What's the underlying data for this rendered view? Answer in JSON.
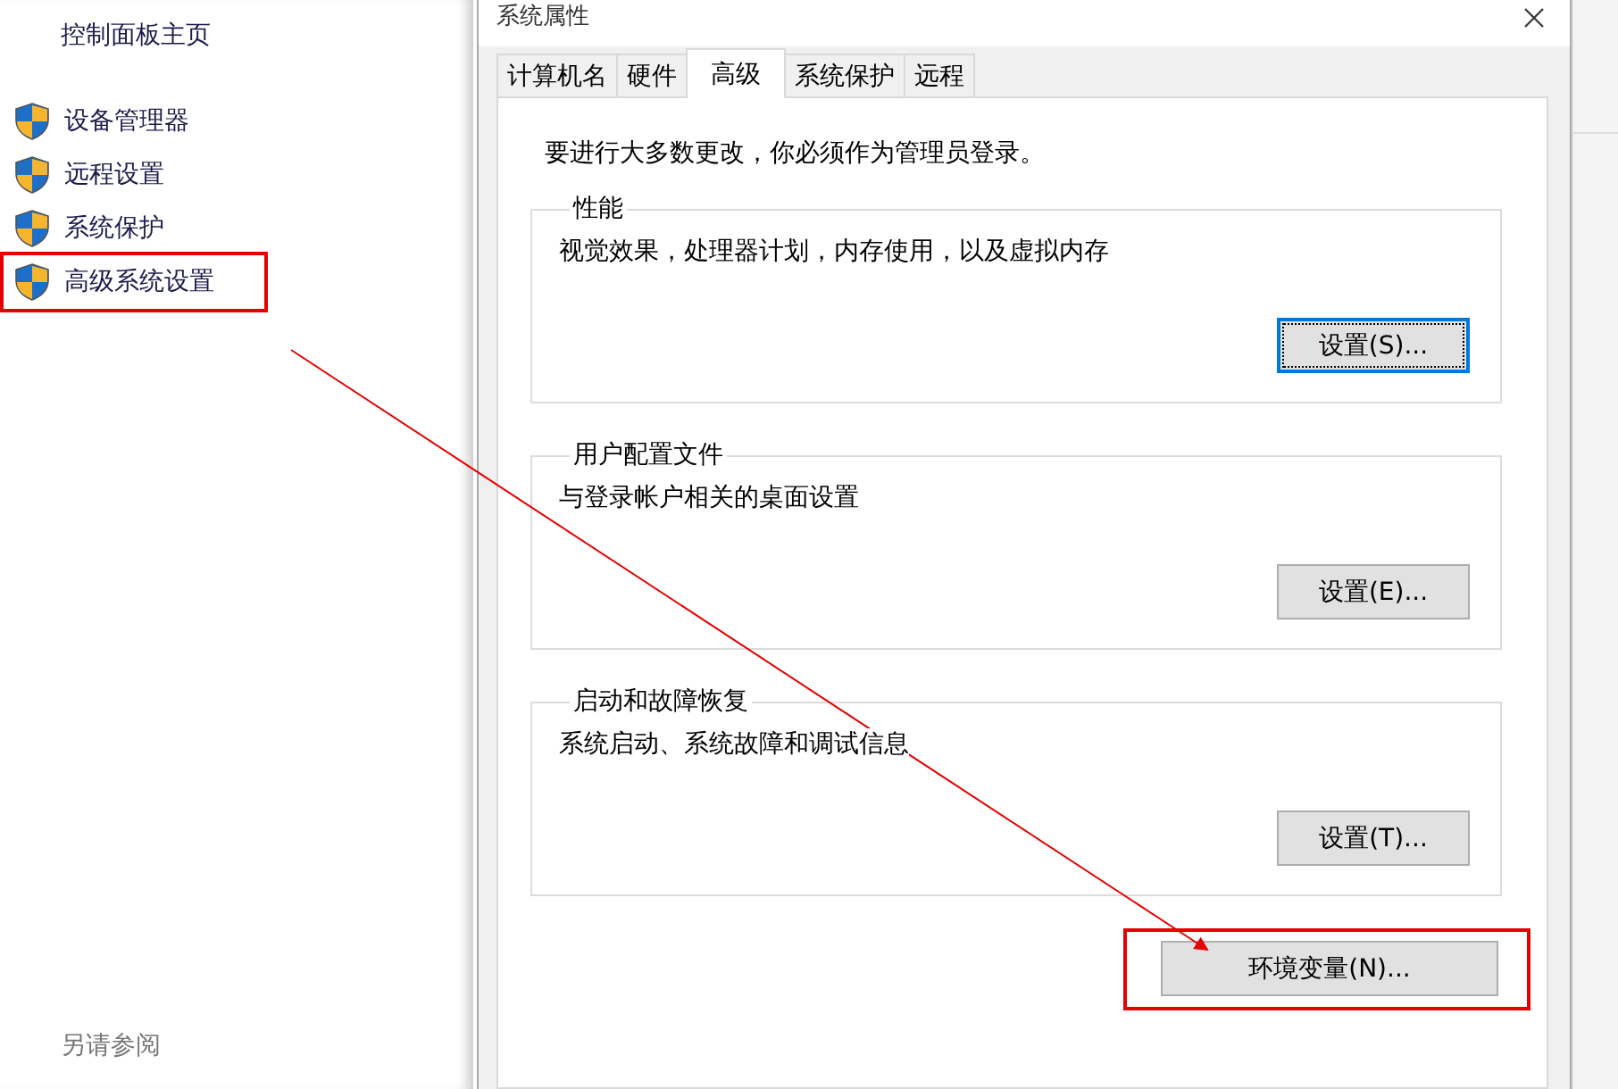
{
  "sidebar": {
    "home_link": "控制面板主页",
    "items": [
      {
        "label": "设备管理器",
        "highlighted": false
      },
      {
        "label": "远程设置",
        "highlighted": false
      },
      {
        "label": "系统保护",
        "highlighted": false
      },
      {
        "label": "高级系统设置",
        "highlighted": true
      }
    ],
    "see_also": "另请参阅"
  },
  "dialog": {
    "title": "系统属性",
    "tabs": [
      {
        "label": "计算机名",
        "selected": false
      },
      {
        "label": "硬件",
        "selected": false
      },
      {
        "label": "高级",
        "selected": true
      },
      {
        "label": "系统保护",
        "selected": false
      },
      {
        "label": "远程",
        "selected": false
      }
    ],
    "notice": "要进行大多数更改，你必须作为管理员登录。",
    "groups": [
      {
        "title": "性能",
        "description": "视觉效果，处理器计划，内存使用，以及虚拟内存",
        "button": {
          "label": "设置(S)...",
          "focused": true
        }
      },
      {
        "title": "用户配置文件",
        "description": "与登录帐户相关的桌面设置",
        "button": {
          "label": "设置(E)...",
          "focused": false
        }
      },
      {
        "title": "启动和故障恢复",
        "description": "系统启动、系统故障和调试信息",
        "button": {
          "label": "设置(T)...",
          "focused": false
        }
      }
    ],
    "env_button": {
      "label": "环境变量(N)...",
      "highlighted": true
    }
  }
}
